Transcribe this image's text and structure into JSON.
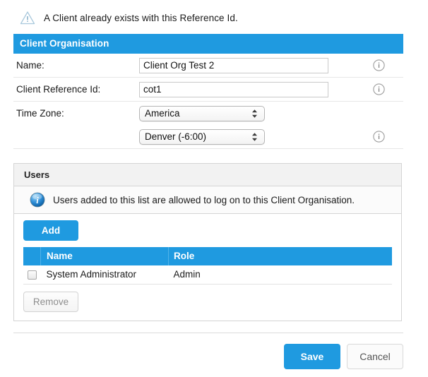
{
  "alert": {
    "icon": "warning-triangle-icon",
    "message": "A Client already exists with this Reference Id."
  },
  "client_organisation": {
    "section_title": "Client Organisation",
    "fields": [
      {
        "label": "Name:",
        "value": "Client Org Test 2",
        "placeholder": "",
        "info_icon": "info-circle-icon"
      },
      {
        "label": "Client Reference Id:",
        "value": "cot1",
        "placeholder": "",
        "info_icon": "info-circle-icon"
      }
    ],
    "timezone": {
      "label": "Time Zone:",
      "region_value": "America",
      "city_value": "Denver (-6:00)",
      "info_icon": "info-circle-icon"
    }
  },
  "users": {
    "panel_title": "Users",
    "note_icon": "info-blue-glossy-icon",
    "note": "Users added to this list are allowed to log on to this Client Organisation.",
    "add_label": "Add",
    "remove_label": "Remove",
    "columns": [
      "",
      "Name",
      "Role"
    ],
    "rows": [
      {
        "checked": false,
        "name": "System Administrator",
        "role": "Admin"
      }
    ]
  },
  "footer": {
    "save_label": "Save",
    "cancel_label": "Cancel"
  },
  "colors": {
    "accent_blue": "#1f9ae0",
    "header_text": "#ffffff",
    "panel_border": "#d4d4d4",
    "disabled_text": "#8e8e8e"
  }
}
